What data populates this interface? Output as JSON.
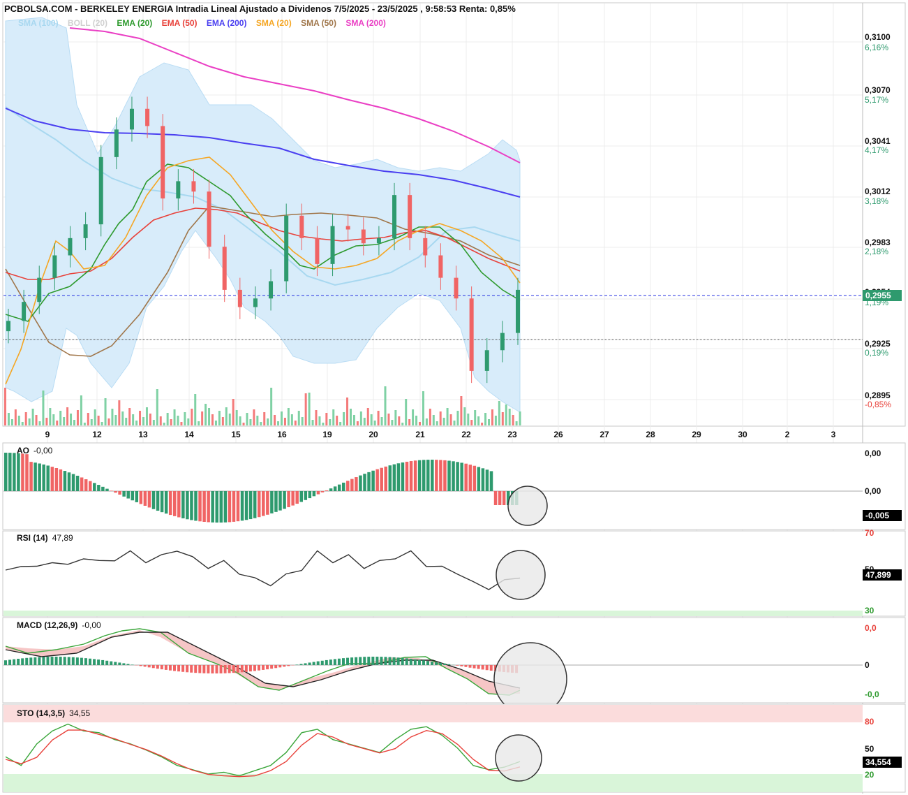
{
  "header": {
    "title": "PCBOLSA.COM - BERKELEY ENERGIA Intradia Lineal Ajustado a Dividenos 7/5/2025 - 23/5/2025 , 9:58:53 Renta: 0,85%"
  },
  "legend": [
    {
      "label": "SMA (100)",
      "color": "#a8d8f0"
    },
    {
      "label": "BOLL (20)",
      "color": "#d0d0d0"
    },
    {
      "label": "EMA (20)",
      "color": "#2e9a2e"
    },
    {
      "label": "EMA (50)",
      "color": "#e8413a"
    },
    {
      "label": "EMA (200)",
      "color": "#4a3ff0"
    },
    {
      "label": "SMA (20)",
      "color": "#f5a623"
    },
    {
      "label": "SMA (50)",
      "color": "#a0764a"
    },
    {
      "label": "SMA (200)",
      "color": "#ea3fc4"
    }
  ],
  "price_axis": [
    {
      "value": "0,3100",
      "pct": "6,16%",
      "pct_color": "#2e9a6e"
    },
    {
      "value": "0,3070",
      "pct": "5,17%",
      "pct_color": "#2e9a6e"
    },
    {
      "value": "0,3041",
      "pct": "4,17%",
      "pct_color": "#2e9a6e"
    },
    {
      "value": "0,3012",
      "pct": "3,18%",
      "pct_color": "#2e9a6e"
    },
    {
      "value": "0,2983",
      "pct": "2,18%",
      "pct_color": "#2e9a6e"
    },
    {
      "value": "0,2954",
      "pct": "1,19%",
      "pct_color": "#2e9a6e"
    },
    {
      "value": "0,2925",
      "pct": "0,19%",
      "pct_color": "#2e9a6e"
    },
    {
      "value": "0,2895",
      "pct": "-0,85%",
      "pct_color": "#e8413a"
    }
  ],
  "last_price": {
    "label": "0,2955",
    "color": "#2e9a6e"
  },
  "x_axis": [
    "9",
    "12",
    "13",
    "14",
    "15",
    "16",
    "19",
    "20",
    "21",
    "22",
    "23",
    "26",
    "27",
    "28",
    "29",
    "30",
    "2",
    "3"
  ],
  "indicators": {
    "ao": {
      "name": "AO",
      "value": "-0,00",
      "axis": [
        "0,00",
        "0,00"
      ],
      "last": "-0,005"
    },
    "rsi": {
      "name": "RSI (14)",
      "value": "47,89",
      "axis": [
        "70",
        "50",
        "30"
      ],
      "last": "47,899"
    },
    "macd": {
      "name": "MACD (12,26,9)",
      "value": "-0,00",
      "axis": [
        "0,0",
        "0",
        "-0,0"
      ]
    },
    "sto": {
      "name": "STO (14,3,5)",
      "value": "34,55",
      "axis": [
        "80",
        "50",
        "20"
      ],
      "last": "34,554"
    }
  },
  "chart_data": [
    {
      "type": "candlestick",
      "title": "PCBOLSA.COM - BERKELEY ENERGIA Intradia Lineal Ajustado a Dividenos 7/5/2025 - 23/5/2025 , 9:58:53 Renta: 0,85%",
      "ylim": [
        0.288,
        0.3115
      ],
      "last": 0.2955,
      "reference": 0.293,
      "overlays_approx": {
        "SMA (200)": [
          0.3102,
          0.3098,
          0.3091,
          0.3082,
          0.3072,
          0.3062,
          0.3051,
          0.3038,
          0.3026
        ],
        "EMA (200)": [
          0.3064,
          0.3053,
          0.3048,
          0.3045,
          0.3042,
          0.3038,
          0.3032,
          0.3023,
          0.3015,
          0.3008
        ]
      },
      "close_approx": [
        0.2937,
        0.2948,
        0.2962,
        0.2975,
        0.2985,
        0.2993,
        0.3032,
        0.3048,
        0.306,
        0.305,
        0.3008,
        0.3018,
        0.3012,
        0.298,
        0.2955,
        0.2945,
        0.295,
        0.296,
        0.2998,
        0.2985,
        0.297,
        0.2992,
        0.299,
        0.2982,
        0.2985,
        0.301,
        0.2985,
        0.2975,
        0.2962,
        0.295,
        0.2908,
        0.292,
        0.293,
        0.2955
      ]
    },
    {
      "type": "bar",
      "title": "AO",
      "value": -0.0,
      "last": -0.005
    },
    {
      "type": "line",
      "title": "RSI (14)",
      "ylim": [
        30,
        70
      ],
      "last": 47.899,
      "values_approx": [
        50,
        54,
        52,
        56,
        53,
        58,
        55,
        57,
        60,
        56,
        58,
        62,
        57,
        53,
        55,
        50,
        46,
        44,
        48,
        52,
        60,
        56,
        58,
        53,
        55,
        58,
        60,
        54,
        52,
        50,
        44,
        42,
        45,
        48
      ]
    },
    {
      "type": "line",
      "title": "MACD (12,26,9)",
      "value": -0.0
    },
    {
      "type": "line",
      "title": "STO (14,3,5)",
      "ylim": [
        0,
        100
      ],
      "last": 34.554,
      "values_approx": [
        40,
        30,
        55,
        70,
        78,
        70,
        68,
        60,
        55,
        48,
        40,
        30,
        25,
        20,
        22,
        18,
        24,
        30,
        45,
        68,
        72,
        60,
        55,
        50,
        45,
        60,
        72,
        75,
        65,
        50,
        30,
        25,
        28,
        34.5
      ]
    }
  ]
}
